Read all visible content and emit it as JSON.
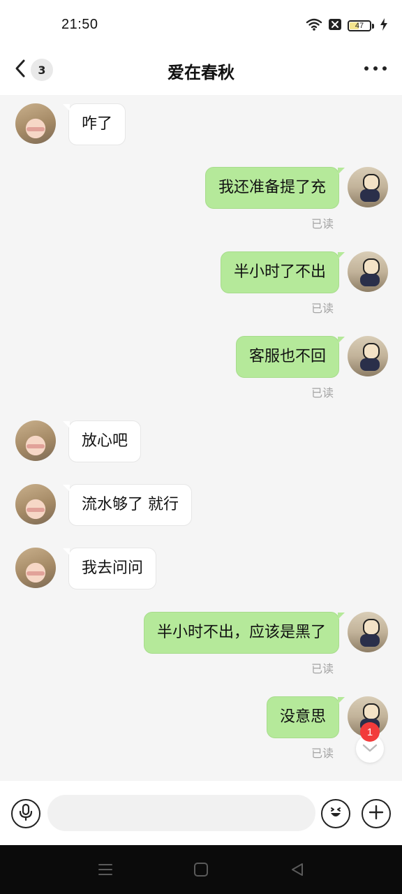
{
  "status": {
    "time": "21:50",
    "battery": 47,
    "battery_text": "47",
    "icons": [
      "wifi-icon",
      "x-box-icon",
      "battery-icon",
      "charging-bolt-icon"
    ]
  },
  "header": {
    "back_icon": "chevron-left-icon",
    "unread_count": "3",
    "title": "爱在春秋",
    "more_icon": "more-horizontal-icon"
  },
  "messages": [
    {
      "side": "in",
      "text": "咋了"
    },
    {
      "side": "out",
      "text": "我还准备提了充",
      "status": "已读"
    },
    {
      "side": "out",
      "text": "半小时了不出",
      "status": "已读"
    },
    {
      "side": "out",
      "text": "客服也不回",
      "status": "已读"
    },
    {
      "side": "in",
      "text": "放心吧"
    },
    {
      "side": "in",
      "text": "流水够了 就行"
    },
    {
      "side": "in",
      "text": "我去问问"
    },
    {
      "side": "out",
      "text": "半小时不出，应该是黑了",
      "status": "已读"
    },
    {
      "side": "out",
      "text": "没意思",
      "status": "已读"
    }
  ],
  "jump_to_new": {
    "badge": "1",
    "icon": "chevron-down-icon"
  },
  "input_bar": {
    "voice_icon": "microphone-icon",
    "placeholder": "",
    "emoji_icon": "smile-emoji-icon",
    "plus_icon": "plus-icon"
  },
  "nav": {
    "icons": [
      "menu-icon",
      "home-square-icon",
      "back-triangle-icon"
    ]
  },
  "colors": {
    "outgoing_bubble": "#b5e99a",
    "incoming_bubble": "#ffffff",
    "badge_red": "#f23b3b",
    "chat_background": "#f5f5f5"
  }
}
